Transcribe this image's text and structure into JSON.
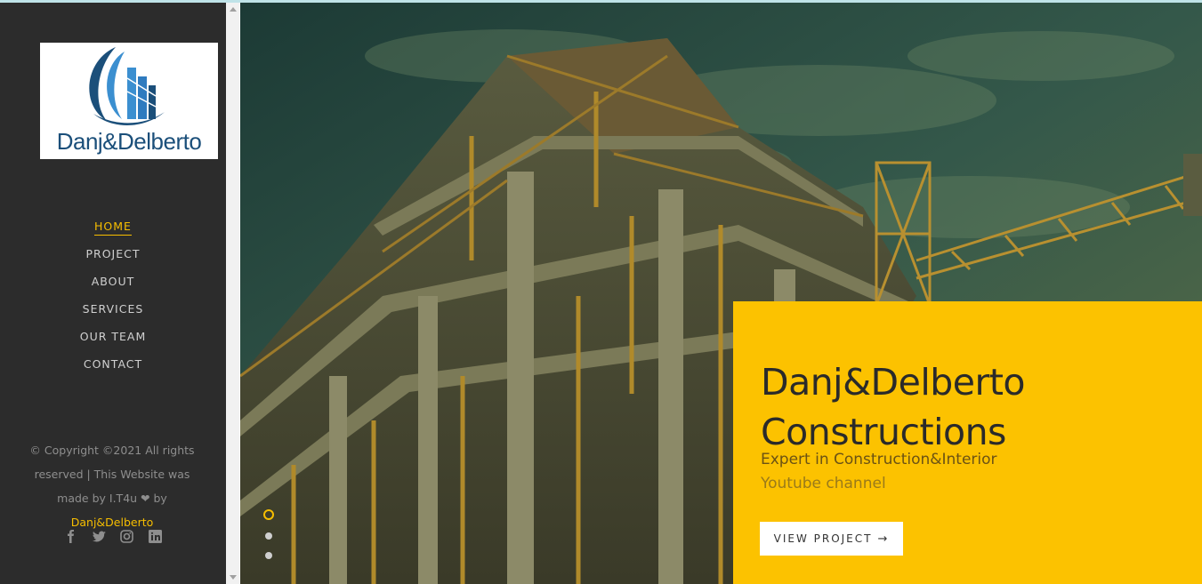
{
  "logo": {
    "text": "Danj&Delberto"
  },
  "nav": {
    "items": [
      {
        "label": "HOME",
        "active": true
      },
      {
        "label": "PROJECT",
        "active": false
      },
      {
        "label": "ABOUT",
        "active": false
      },
      {
        "label": "SERVICES",
        "active": false
      },
      {
        "label": "OUR TEAM",
        "active": false
      },
      {
        "label": "CONTACT",
        "active": false
      }
    ]
  },
  "footer": {
    "copyright_prefix": "© Copyright ©2021 All rights reserved | This Website was made by I.T4u ❤ by",
    "brand_link": "Danj&Delberto",
    "social_icons": [
      "facebook-icon",
      "twitter-icon",
      "instagram-icon",
      "linkedin-icon"
    ]
  },
  "hero": {
    "title_line1": "Danj&Delberto",
    "title_line2": "Constructions",
    "subtitle_line1": "Expert in Construction&Interior",
    "subtitle_line2": "Youtube channel",
    "button_label": "VIEW PROJECT",
    "button_icon": "arrow-right-icon",
    "slides": 3,
    "active_slide": 1
  },
  "colors": {
    "accent": "#f7be00",
    "card": "#fcc200",
    "sidebar": "#2c2c2c"
  }
}
